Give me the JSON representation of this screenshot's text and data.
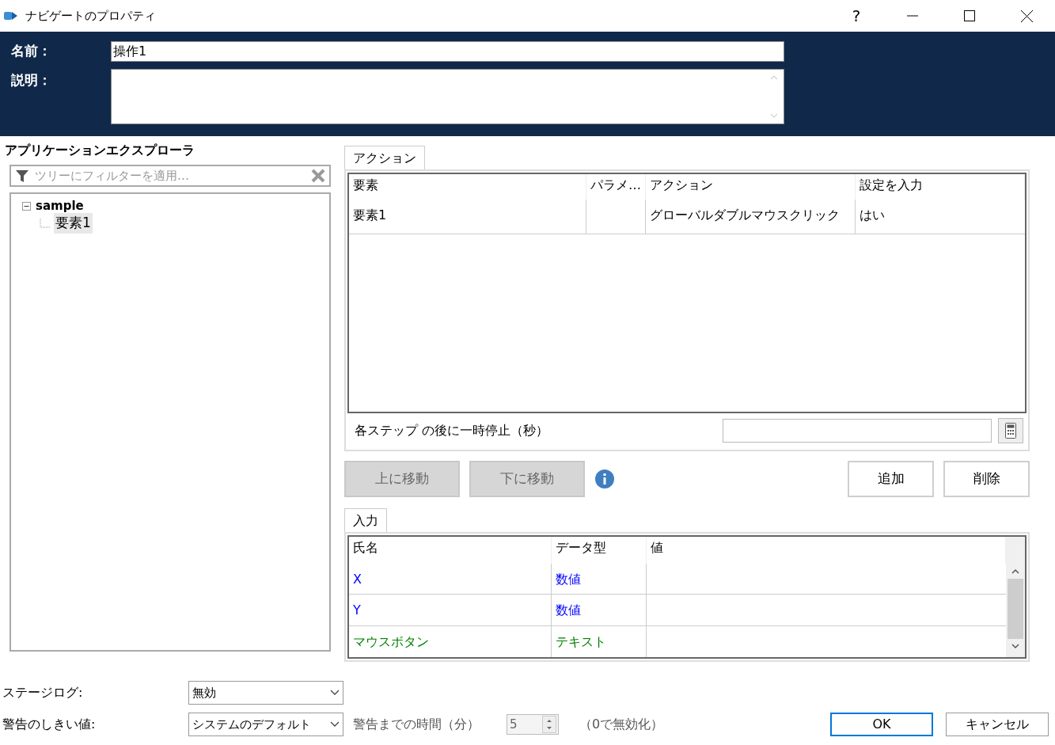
{
  "window": {
    "title": "ナビゲートのプロパティ",
    "help": "?"
  },
  "name_field": {
    "label": "名前：",
    "value": "操作1"
  },
  "description_field": {
    "label": "説明："
  },
  "explorer": {
    "title": "アプリケーションエクスプローラ",
    "filter": {
      "placeholder": "ツリーにフィルターを適用…"
    },
    "tree": [
      {
        "label": "sample",
        "expanded": true,
        "selected": false,
        "children": [
          {
            "label": "要素1",
            "selected": true
          }
        ]
      }
    ]
  },
  "actions": {
    "tab": "アクション",
    "columns": [
      "要素",
      "パラメ…",
      "アクション",
      "設定を入力"
    ],
    "rows": [
      {
        "element": "要素1",
        "action": "グローバルダブルマウスクリック",
        "enter_settings": "はい"
      }
    ],
    "pause": {
      "label": "各ステップ の後に一時停止（秒）"
    }
  },
  "buttons": [
    {
      "label": "上に移動",
      "disabled": true
    },
    {
      "label": "下に移動",
      "disabled": true
    },
    {
      "label": "追加",
      "disabled": false
    },
    {
      "label": "削除",
      "disabled": false
    }
  ],
  "inputs": {
    "tab": "入力",
    "columns": [
      "氏名",
      "データ型",
      "値"
    ],
    "rows": [
      {
        "name": "X",
        "type": "数値",
        "color": "#0000ff"
      },
      {
        "name": "Y",
        "type": "数値",
        "color": "#0000ff"
      },
      {
        "name": "マウスボタン",
        "type": "テキスト",
        "color": "#008000"
      }
    ]
  },
  "footer": {
    "stage_log": {
      "label": "ステージログ:",
      "value": "無効"
    },
    "warning_threshold": {
      "label": "警告のしきい値:",
      "value": "システムのデフォルト"
    },
    "warning_time": {
      "label": "警告までの時間（分）",
      "value": "5",
      "hint": "（0で無効化）"
    },
    "dialog_buttons": [
      {
        "label": "OK",
        "default": true
      },
      {
        "label": "キャンセル",
        "default": false
      }
    ]
  }
}
